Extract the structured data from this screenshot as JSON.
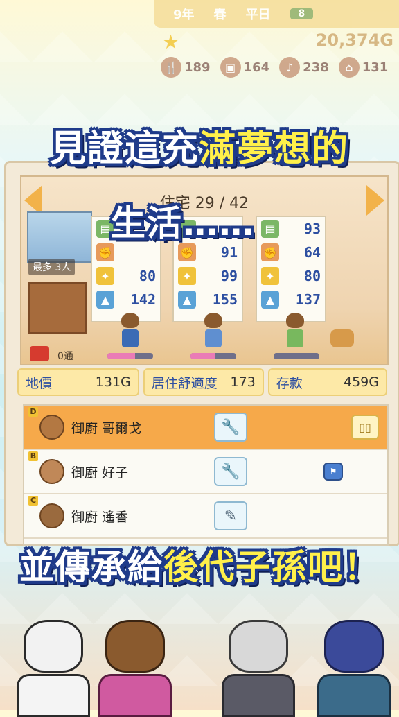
{
  "hud": {
    "year": "9年",
    "season": "春",
    "day_type": "平日",
    "counter": "8",
    "money": "20,374G",
    "stats": [
      {
        "icon": "food-icon",
        "value": "189"
      },
      {
        "icon": "bag-icon",
        "value": "164"
      },
      {
        "icon": "music-icon",
        "value": "238"
      },
      {
        "icon": "house-icon",
        "value": "131"
      }
    ]
  },
  "captions": {
    "top_plain": "見證這充",
    "top_highlight": "滿夢想的",
    "middle": "生活……",
    "bottom_plain": "並傳承給",
    "bottom_highlight": "後代子孫吧！"
  },
  "room": {
    "title": "住宅 29 / 42",
    "max_residents": "最多 3人",
    "mail_count": "0通",
    "cards": [
      {
        "book": "",
        "power": "",
        "spark": "80",
        "tree": "142"
      },
      {
        "book": "",
        "power": "91",
        "spark": "99",
        "tree": "155"
      },
      {
        "book": "93",
        "power": "64",
        "spark": "80",
        "tree": "137"
      }
    ],
    "residents": [
      {
        "bar_fill": 0.6
      },
      {
        "bar_fill": 0.55
      },
      {
        "bar_fill": 0.0
      }
    ]
  },
  "info": {
    "land_label": "地價",
    "land_value": "131G",
    "comfort_label": "居住舒適度",
    "comfort_value": "173",
    "savings_label": "存款",
    "savings_value": "459G"
  },
  "list": [
    {
      "rank": "D",
      "name": "御廚 哥爾戈",
      "tool_icon": "wrench-icon",
      "extra": "seat"
    },
    {
      "rank": "B",
      "name": "御廚 好子",
      "tool_icon": "wrench-icon",
      "extra": "pin"
    },
    {
      "rank": "C",
      "name": "御廚 遙香",
      "tool_icon": "pencil-icon",
      "extra": ""
    }
  ],
  "colors": {
    "accent_orange": "#f6a94a",
    "caption_outline": "#1f3b8a",
    "caption_highlight": "#fff04a",
    "stat_blue": "#2d4fa1"
  }
}
